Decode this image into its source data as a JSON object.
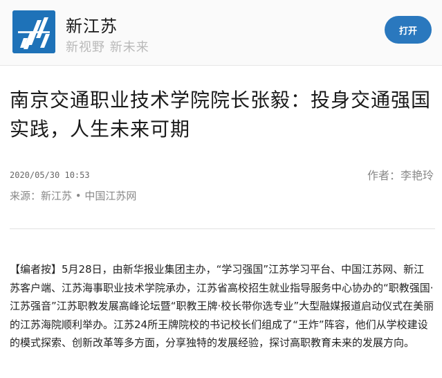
{
  "header": {
    "app_name": "新江苏",
    "slogan": "新视野  新未来",
    "open_button_label": "打开",
    "brand_color": "#1e72b8"
  },
  "article": {
    "title": "南京交通职业技术学院院长张毅：投身交通强国实践，人生未来可期",
    "date": "2020/05/30 10:53",
    "author": "作者：李艳玲",
    "source": "来源：新江苏 • 中国江苏网",
    "editor_note": "【编者按】5月28日，由新华报业集团主办，“学习强国”江苏学习平台、中国江苏网、新江苏客户端、江苏海事职业技术学院承办，江苏省高校招生就业指导服务中心协办的“职教强国·江苏强音”江苏职教发展高峰论坛暨“职教王牌·校长带你选专业”大型融媒报道启动仪式在美丽的江苏海院顺利举办。江苏24所王牌院校的书记校长们组成了“王炸”阵容，他们从学校建设的模式探索、创新改革等多方面，分享独特的发展经验，探讨高职教育未来的发展方向。"
  }
}
